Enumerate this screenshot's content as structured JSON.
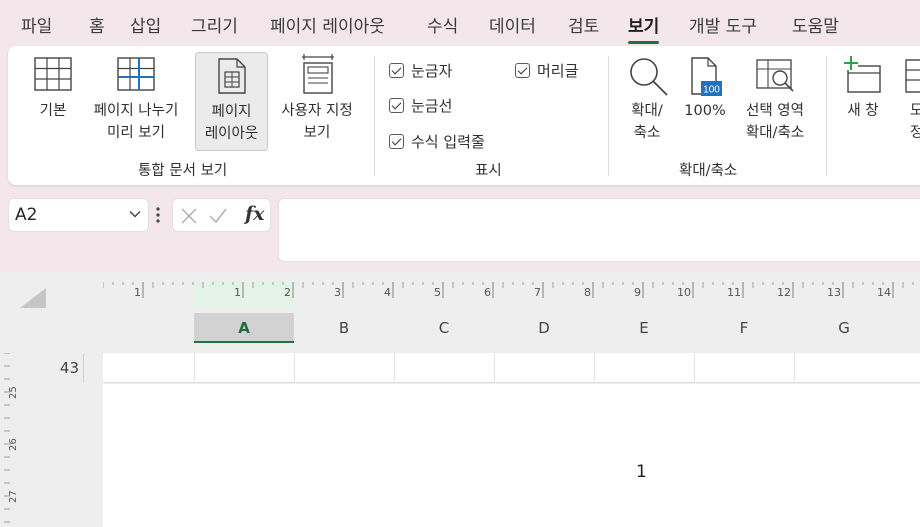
{
  "menu_tabs": [
    "파일",
    "홈",
    "삽입",
    "그리기",
    "페이지 레이아웃",
    "수식",
    "데이터",
    "검토",
    "보기",
    "개발 도구",
    "도움말"
  ],
  "active_tab": "보기",
  "ribbon": {
    "workbook_views": {
      "group_label": "통합 문서 보기",
      "normal": "기본",
      "page_break_line1": "페이지 나누기",
      "page_break_line2": "미리 보기",
      "page_layout_line1": "페이지",
      "page_layout_line2": "레이아웃",
      "custom_line1": "사용자 지정",
      "custom_line2": "보기"
    },
    "show": {
      "group_label": "표시",
      "ruler": "눈금자",
      "headings": "머리글",
      "gridlines": "눈금선",
      "formula_bar": "수식 입력줄"
    },
    "zoom": {
      "group_label": "확대/축소",
      "zoom_line1": "확대/",
      "zoom_line2": "축소",
      "hundred": "100%",
      "hundred_icon_text": "100",
      "selection_line1": "선택 영역",
      "selection_line2": "확대/축소"
    },
    "window": {
      "new_window": "새 창",
      "arrange_partial_line1": "모",
      "arrange_partial_line2": "정"
    }
  },
  "formula_bar": {
    "name_box": "A2",
    "fx_label": "fx",
    "formula_value": ""
  },
  "sheet": {
    "ruler_numbers": [
      "1",
      "1",
      "2",
      "3",
      "4",
      "5",
      "6",
      "7",
      "8",
      "9",
      "10",
      "11",
      "12",
      "13",
      "14"
    ],
    "columns": [
      "A",
      "B",
      "C",
      "D",
      "E",
      "F",
      "G"
    ],
    "selected_column": "A",
    "row_number": "43",
    "vertical_ruler_numbers": [
      "25",
      "26",
      "27"
    ],
    "cell_value": "1"
  },
  "colors": {
    "accent_green": "#217346",
    "background": "#f3e7ec",
    "zoom_icon_blue": "#1e73be"
  }
}
